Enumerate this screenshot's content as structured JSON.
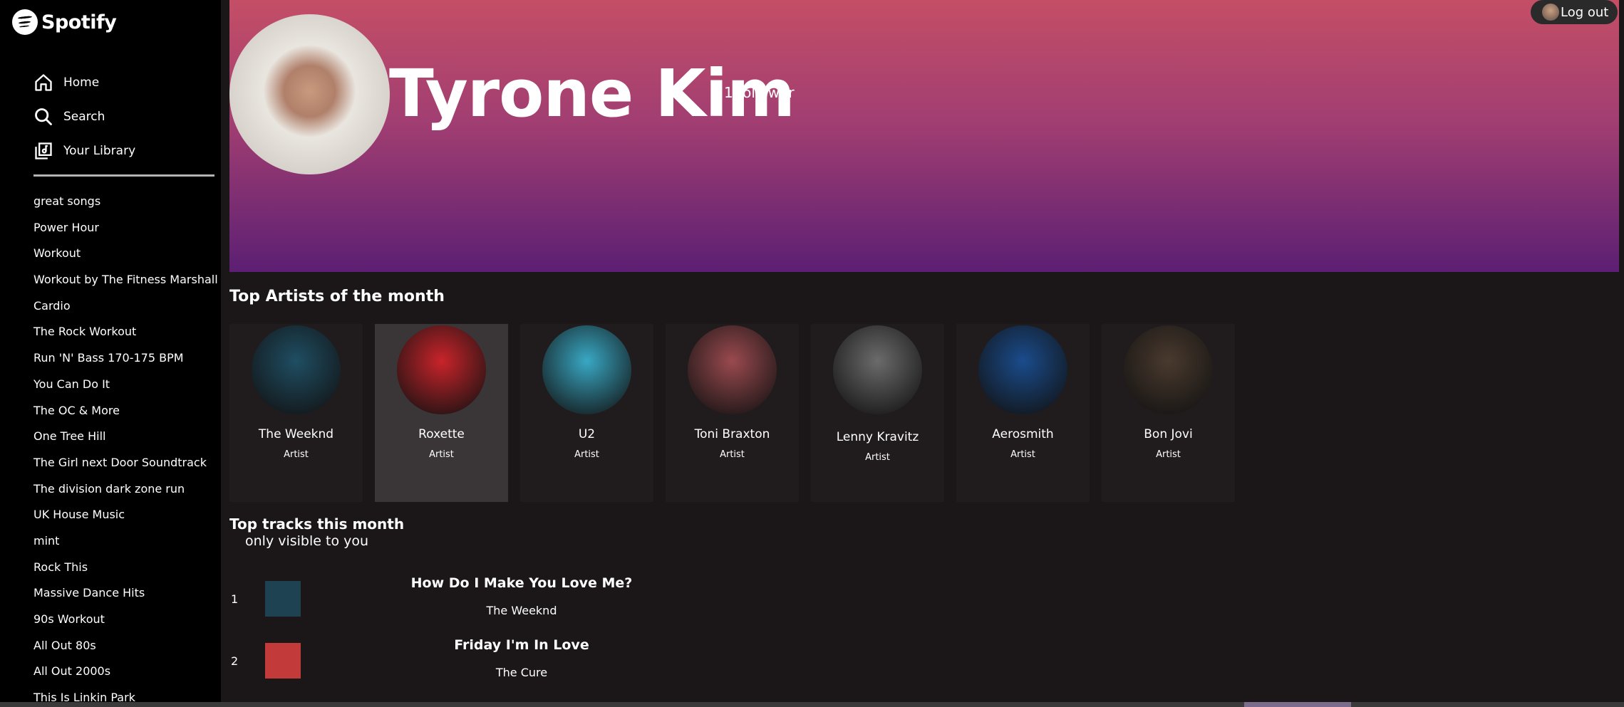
{
  "brand": {
    "name": "Spotify"
  },
  "nav": {
    "home": "Home",
    "search": "Search",
    "library": "Your Library"
  },
  "playlists": [
    "great songs",
    "Power Hour",
    "Workout",
    "Workout by The Fitness Marshall",
    "Cardio",
    "The Rock Workout",
    "Run 'N' Bass 170-175 BPM",
    "You Can Do It",
    "The OC & More",
    "One Tree Hill",
    "The Girl next Door Soundtrack",
    "The division dark zone run",
    "UK House Music",
    "mint",
    "Rock This",
    "Massive Dance Hits",
    "90s Workout",
    "All Out 80s",
    "All Out 2000s",
    "This Is Linkin Park"
  ],
  "profile": {
    "name": "Tyrone Kim",
    "followers": "1 follower"
  },
  "logout_label": "Log out",
  "top_artists": {
    "title": "Top Artists of the month",
    "items": [
      {
        "name": "The Weeknd",
        "type": "Artist",
        "color": "#1f4e63"
      },
      {
        "name": "Roxette",
        "type": "Artist",
        "color": "#c8242a"
      },
      {
        "name": "U2",
        "type": "Artist",
        "color": "#39a8c4"
      },
      {
        "name": "Toni Braxton",
        "type": "Artist",
        "color": "#9a4a4f"
      },
      {
        "name": "Lenny Kravitz",
        "type": "Artist",
        "color": "#6b6b6b"
      },
      {
        "name": "Aerosmith",
        "type": "Artist",
        "color": "#1a4c8c"
      },
      {
        "name": "Bon Jovi",
        "type": "Artist",
        "color": "#4a3a2e"
      }
    ]
  },
  "top_tracks": {
    "title": "Top tracks this month",
    "subtitle": "only visible to you",
    "items": [
      {
        "rank": "1",
        "title": "How Do I Make You Love Me?",
        "artist": "The Weeknd",
        "color": "#1e4252"
      },
      {
        "rank": "2",
        "title": "Friday I'm In Love",
        "artist": "The Cure",
        "color": "#c23a3a"
      }
    ]
  }
}
